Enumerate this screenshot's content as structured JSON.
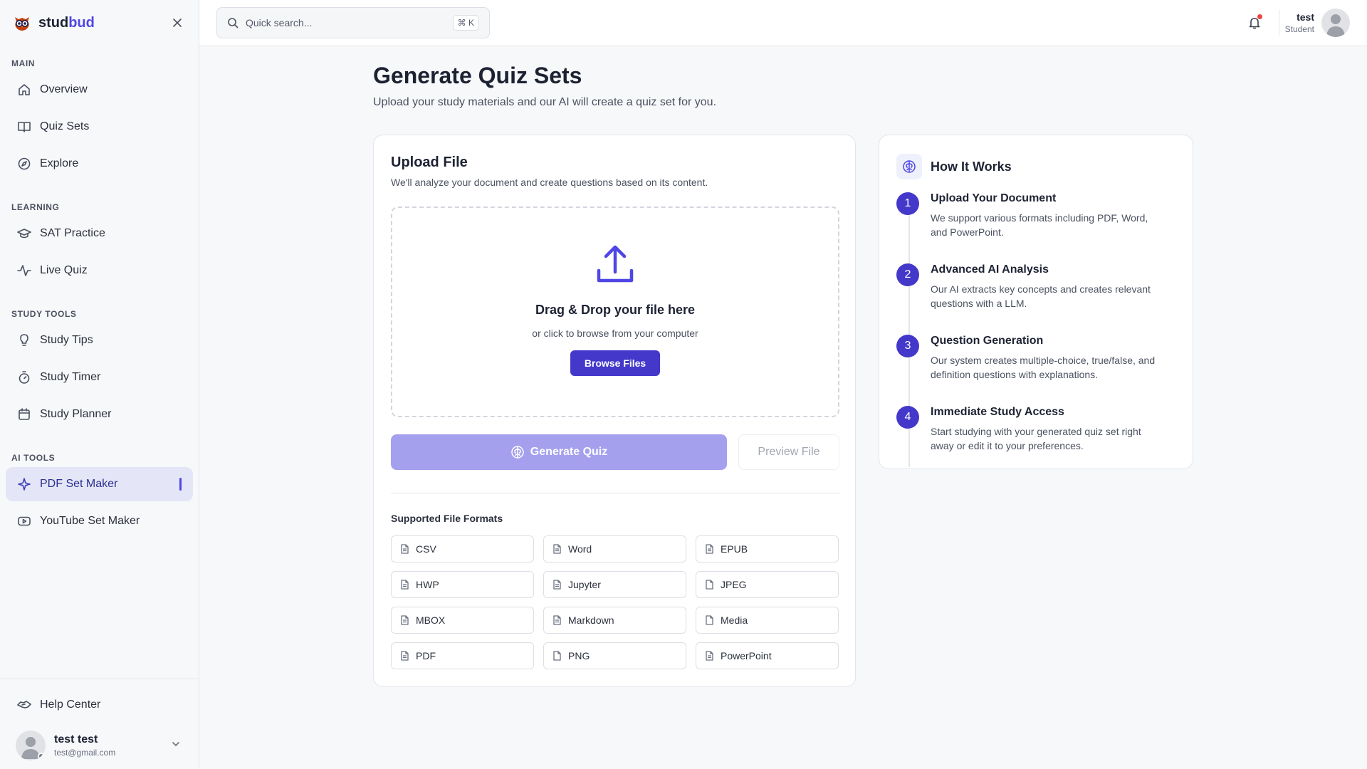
{
  "brand": {
    "name_part1": "stud",
    "name_part2": "bud",
    "accent": "#4f46e5"
  },
  "sidebar": {
    "sections": [
      {
        "label": "MAIN",
        "items": [
          {
            "label": "Overview",
            "icon": "home-icon"
          },
          {
            "label": "Quiz Sets",
            "icon": "book-open-icon"
          },
          {
            "label": "Explore",
            "icon": "compass-icon"
          }
        ]
      },
      {
        "label": "LEARNING",
        "items": [
          {
            "label": "SAT Practice",
            "icon": "graduation-cap-icon"
          },
          {
            "label": "Live Quiz",
            "icon": "activity-icon"
          }
        ]
      },
      {
        "label": "STUDY TOOLS",
        "items": [
          {
            "label": "Study Tips",
            "icon": "lightbulb-icon"
          },
          {
            "label": "Study Timer",
            "icon": "stopwatch-icon"
          },
          {
            "label": "Study Planner",
            "icon": "calendar-icon"
          }
        ]
      },
      {
        "label": "AI TOOLS",
        "items": [
          {
            "label": "PDF Set Maker",
            "icon": "sparkle-icon",
            "active": true
          },
          {
            "label": "YouTube Set Maker",
            "icon": "youtube-icon"
          }
        ]
      }
    ],
    "help_label": "Help Center",
    "user": {
      "name": "test test",
      "email": "test@gmail.com"
    }
  },
  "topbar": {
    "search_placeholder": "Quick search...",
    "shortcut": "⌘ K",
    "user": {
      "name": "test",
      "role": "Student"
    }
  },
  "page": {
    "title": "Generate Quiz Sets",
    "subtitle": "Upload your study materials and our AI will create a quiz set for you."
  },
  "upload": {
    "title": "Upload File",
    "subtitle": "We'll analyze your document and create questions based on its content.",
    "drop_title": "Drag & Drop your file here",
    "drop_subtitle": "or click to browse from your computer",
    "browse_label": "Browse Files",
    "generate_label": "Generate Quiz",
    "preview_label": "Preview File",
    "formats_label": "Supported File Formats",
    "formats": [
      "CSV",
      "Word",
      "EPUB",
      "HWP",
      "Jupyter",
      "JPEG",
      "MBOX",
      "Markdown",
      "Media",
      "PDF",
      "PNG",
      "PowerPoint"
    ]
  },
  "how": {
    "title": "How It Works",
    "steps": [
      {
        "num": "1",
        "title": "Upload Your Document",
        "desc": "We support various formats including PDF, Word, and PowerPoint."
      },
      {
        "num": "2",
        "title": "Advanced AI Analysis",
        "desc": "Our AI extracts key concepts and creates relevant questions with a LLM."
      },
      {
        "num": "3",
        "title": "Question Generation",
        "desc": "Our system creates multiple-choice, true/false, and definition questions with explanations."
      },
      {
        "num": "4",
        "title": "Immediate Study Access",
        "desc": "Start studying with your generated quiz set right away or edit it to your preferences."
      }
    ]
  }
}
